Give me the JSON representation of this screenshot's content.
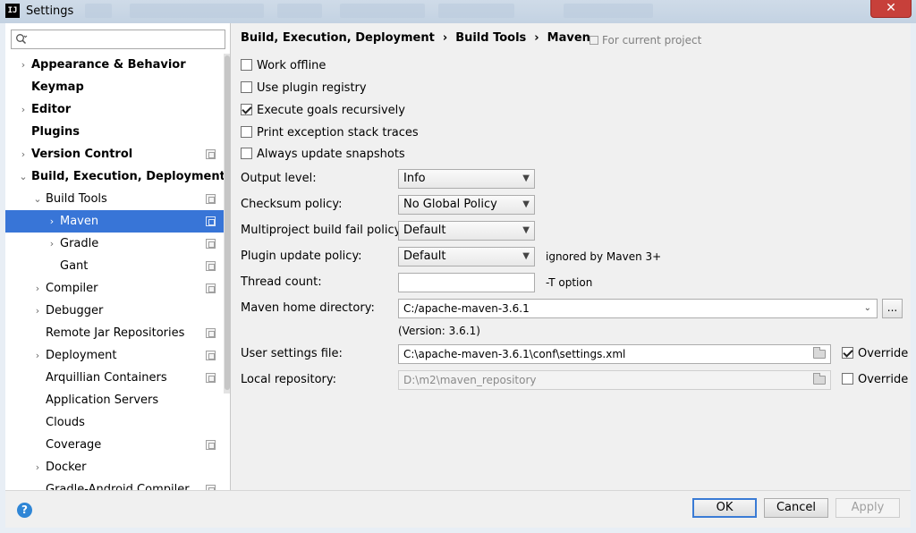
{
  "window": {
    "app_icon": "IJ",
    "title": "Settings",
    "close_symbol": "✕"
  },
  "search": {
    "placeholder": ""
  },
  "sidebar": {
    "items": [
      {
        "label": "Appearance & Behavior",
        "bold": true,
        "arrow": "›",
        "level": 0,
        "project": false,
        "selected": false
      },
      {
        "label": "Keymap",
        "bold": true,
        "arrow": "",
        "level": 0,
        "project": false,
        "selected": false
      },
      {
        "label": "Editor",
        "bold": true,
        "arrow": "›",
        "level": 0,
        "project": false,
        "selected": false
      },
      {
        "label": "Plugins",
        "bold": true,
        "arrow": "",
        "level": 0,
        "project": false,
        "selected": false
      },
      {
        "label": "Version Control",
        "bold": true,
        "arrow": "›",
        "level": 0,
        "project": true,
        "selected": false
      },
      {
        "label": "Build, Execution, Deployment",
        "bold": true,
        "arrow": "⌄",
        "level": 0,
        "project": false,
        "selected": false
      },
      {
        "label": "Build Tools",
        "bold": false,
        "arrow": "⌄",
        "level": 1,
        "project": true,
        "selected": false
      },
      {
        "label": "Maven",
        "bold": false,
        "arrow": "›",
        "level": 2,
        "project": true,
        "selected": true
      },
      {
        "label": "Gradle",
        "bold": false,
        "arrow": "›",
        "level": 2,
        "project": true,
        "selected": false
      },
      {
        "label": "Gant",
        "bold": false,
        "arrow": "",
        "level": 2,
        "project": true,
        "selected": false
      },
      {
        "label": "Compiler",
        "bold": false,
        "arrow": "›",
        "level": 1,
        "project": true,
        "selected": false
      },
      {
        "label": "Debugger",
        "bold": false,
        "arrow": "›",
        "level": 1,
        "project": false,
        "selected": false
      },
      {
        "label": "Remote Jar Repositories",
        "bold": false,
        "arrow": "",
        "level": 1,
        "project": true,
        "selected": false
      },
      {
        "label": "Deployment",
        "bold": false,
        "arrow": "›",
        "level": 1,
        "project": true,
        "selected": false
      },
      {
        "label": "Arquillian Containers",
        "bold": false,
        "arrow": "",
        "level": 1,
        "project": true,
        "selected": false
      },
      {
        "label": "Application Servers",
        "bold": false,
        "arrow": "",
        "level": 1,
        "project": false,
        "selected": false
      },
      {
        "label": "Clouds",
        "bold": false,
        "arrow": "",
        "level": 1,
        "project": false,
        "selected": false
      },
      {
        "label": "Coverage",
        "bold": false,
        "arrow": "",
        "level": 1,
        "project": true,
        "selected": false
      },
      {
        "label": "Docker",
        "bold": false,
        "arrow": "›",
        "level": 1,
        "project": false,
        "selected": false
      },
      {
        "label": "Gradle-Android Compiler",
        "bold": false,
        "arrow": "",
        "level": 1,
        "project": true,
        "selected": false
      }
    ]
  },
  "breadcrumb": {
    "parts": [
      "Build, Execution, Deployment",
      "Build Tools",
      "Maven"
    ],
    "separator": "›"
  },
  "for_project": "For current project",
  "options": {
    "work_offline": {
      "label": "Work offline",
      "checked": false
    },
    "use_plugin_registry": {
      "label": "Use plugin registry",
      "checked": false
    },
    "execute_goals": {
      "label": "Execute goals recursively",
      "checked": true
    },
    "print_exception": {
      "label": "Print exception stack traces",
      "checked": false
    },
    "always_update": {
      "label": "Always update snapshots",
      "checked": false
    }
  },
  "form": {
    "output_level": {
      "label": "Output level:",
      "value": "Info"
    },
    "checksum_policy": {
      "label": "Checksum policy:",
      "value": "No Global Policy"
    },
    "multiproject_fail": {
      "label": "Multiproject build fail policy:",
      "value": "Default"
    },
    "plugin_update": {
      "label": "Plugin update policy:",
      "value": "Default",
      "note": "ignored by Maven 3+"
    },
    "thread_count": {
      "label": "Thread count:",
      "value": "",
      "note": "-T option"
    },
    "maven_home": {
      "label": "Maven home directory:",
      "value": "C:/apache-maven-3.6.1",
      "browse": "...",
      "version": "(Version: 3.6.1)"
    },
    "user_settings": {
      "label": "User settings file:",
      "value": "C:\\apache-maven-3.6.1\\conf\\settings.xml",
      "override_label": "Override",
      "override_checked": true
    },
    "local_repo": {
      "label": "Local repository:",
      "value": "D:\\m2\\maven_repository",
      "override_label": "Override",
      "override_checked": false
    }
  },
  "footer": {
    "help": "?",
    "ok": "OK",
    "cancel": "Cancel",
    "apply": "Apply"
  },
  "colors": {
    "selection": "#3875d7",
    "primary_button_border": "#3a7bd5",
    "close_button": "#c7403a"
  },
  "icons": [
    "search-icon",
    "chevron-right-icon",
    "chevron-down-icon",
    "project-scope-icon",
    "folder-icon",
    "help-icon",
    "dropdown-arrow-icon",
    "close-icon"
  ]
}
